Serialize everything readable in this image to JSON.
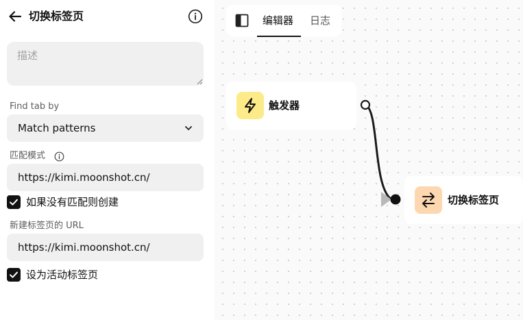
{
  "panel": {
    "title": "切换标签页",
    "description_placeholder": "描述",
    "find_tab_label": "Find tab by",
    "find_tab_value": "Match patterns",
    "pattern_label": "匹配模式",
    "pattern_value": "https://kimi.moonshot.cn/",
    "create_if_missing_label": "如果没有匹配则创建",
    "create_if_missing_checked": true,
    "new_tab_url_label": "新建标签页的 URL",
    "new_tab_url_value": "https://kimi.moonshot.cn/",
    "set_active_label": "设为活动标签页",
    "set_active_checked": true
  },
  "toolbar": {
    "tabs": [
      {
        "label": "编辑器",
        "active": true
      },
      {
        "label": "日志",
        "active": false
      }
    ]
  },
  "canvas": {
    "trigger_node": {
      "label": "触发器",
      "icon": "lightning-icon",
      "color": "#fdeb8a"
    },
    "switch_tab_node": {
      "label": "切换标签页",
      "icon": "switch-arrows-icon",
      "color": "#fdd7b0"
    }
  }
}
